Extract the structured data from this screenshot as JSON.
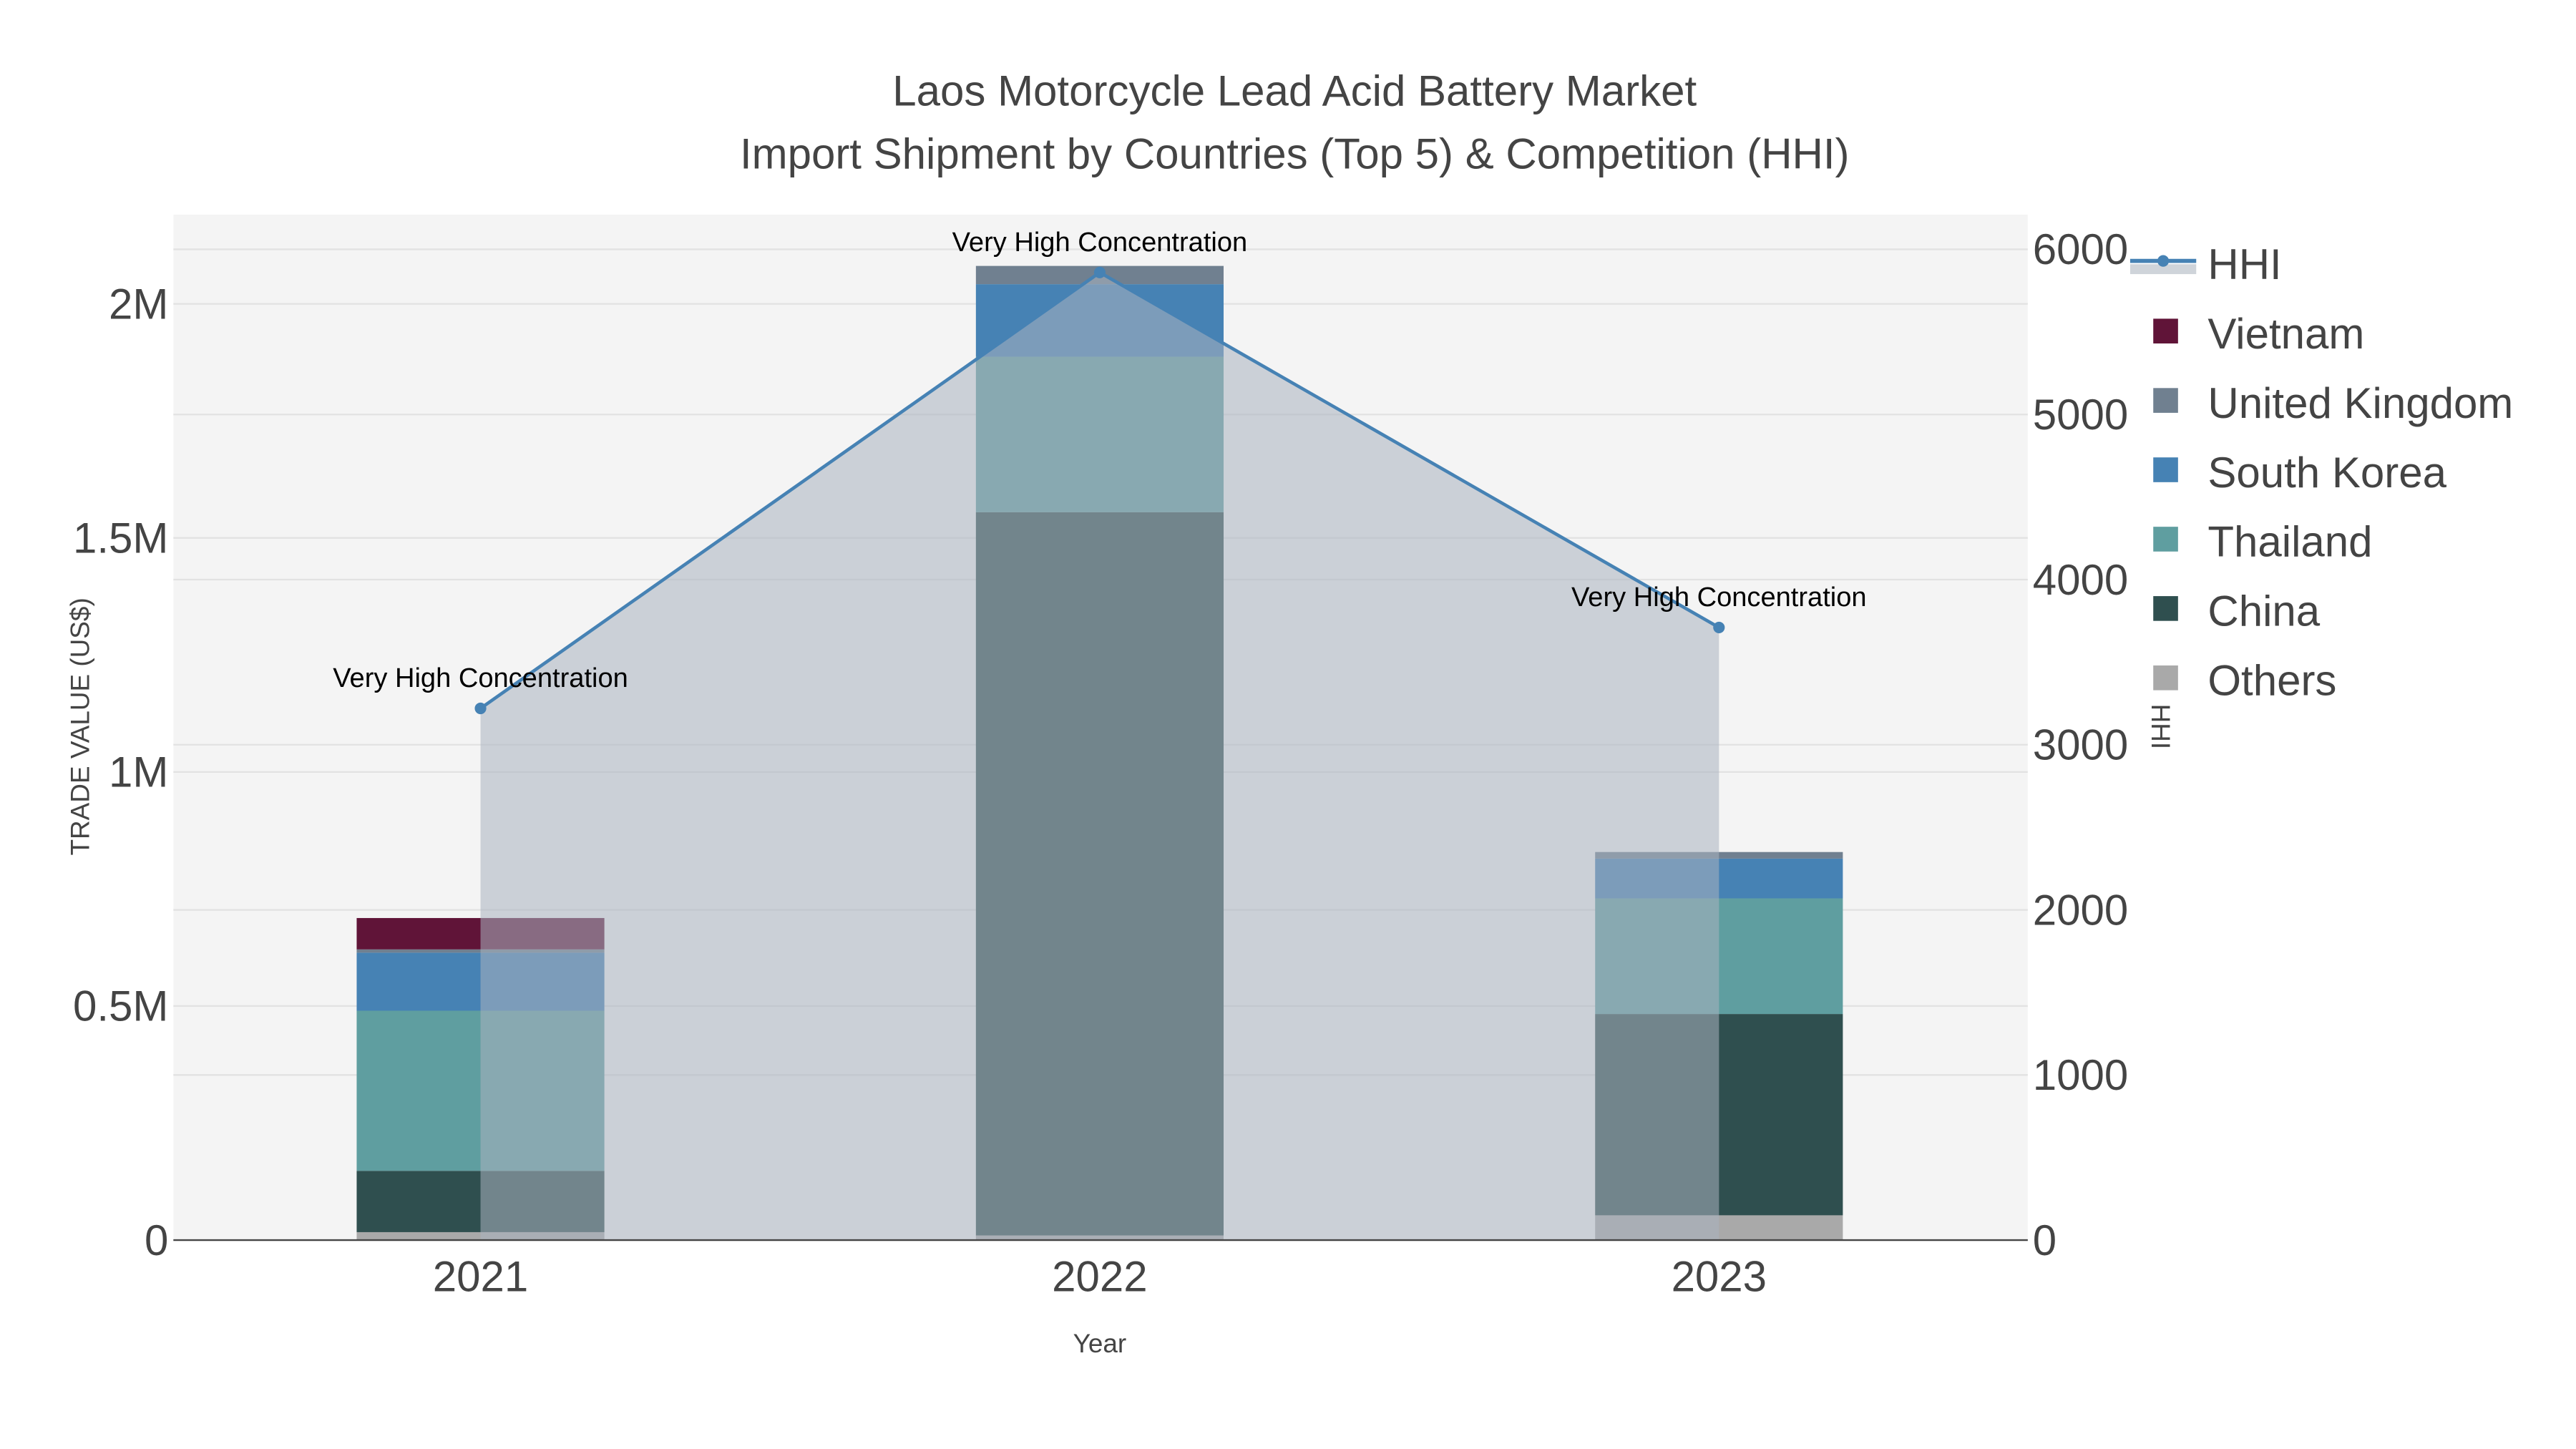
{
  "chart_data": {
    "type": "bar",
    "stacked": true,
    "title": "Laos Motorcycle Lead Acid Battery Market",
    "subtitle": "Import Shipment by Countries (Top 5) & Competition (HHI)",
    "xlabel": "Year",
    "ylabel": "TRADE VALUE (US$)",
    "y2label": "HHI",
    "categories": [
      "2021",
      "2022",
      "2023"
    ],
    "ylim": [
      0,
      2180000
    ],
    "y2lim": [
      0,
      6200
    ],
    "yticks": [
      {
        "v": 0,
        "label": "0"
      },
      {
        "v": 500000,
        "label": "0.5M"
      },
      {
        "v": 1000000,
        "label": "1M"
      },
      {
        "v": 1500000,
        "label": "1.5M"
      },
      {
        "v": 2000000,
        "label": "2M"
      }
    ],
    "y2ticks": [
      {
        "v": 0,
        "label": "0"
      },
      {
        "v": 1000,
        "label": "1000"
      },
      {
        "v": 2000,
        "label": "2000"
      },
      {
        "v": 3000,
        "label": "3000"
      },
      {
        "v": 4000,
        "label": "4000"
      },
      {
        "v": 5000,
        "label": "5000"
      },
      {
        "v": 6000,
        "label": "6000"
      }
    ],
    "series": [
      {
        "name": "Others",
        "color": "#a9a9a9",
        "values": [
          17000,
          10000,
          53000
        ]
      },
      {
        "name": "China",
        "color": "#2f4f4f",
        "values": [
          131000,
          1545000,
          430000
        ]
      },
      {
        "name": "Thailand",
        "color": "#5f9ea0",
        "values": [
          342000,
          332000,
          247000
        ]
      },
      {
        "name": "South Korea",
        "color": "#4682b4",
        "values": [
          124000,
          155000,
          85000
        ]
      },
      {
        "name": "United Kingdom",
        "color": "#708090",
        "values": [
          7000,
          39000,
          14000
        ]
      },
      {
        "name": "Vietnam",
        "color": "#601438",
        "values": [
          67000,
          0,
          0
        ]
      }
    ],
    "hhi": {
      "name": "HHI",
      "color": "#4682b4",
      "values": [
        3220,
        5860,
        3710
      ]
    },
    "annotations": [
      "Very High Concentration",
      "Very High Concentration",
      "Very High Concentration"
    ],
    "legend_order": [
      "HHI",
      "Vietnam",
      "United Kingdom",
      "South Korea",
      "Thailand",
      "China",
      "Others"
    ],
    "legend_position": "right",
    "grid": true
  }
}
